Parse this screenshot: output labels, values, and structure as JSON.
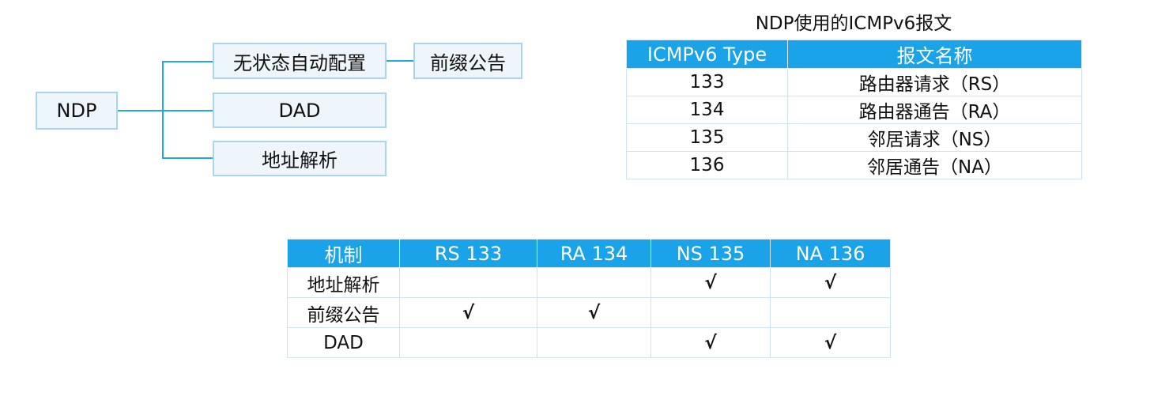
{
  "tree": {
    "root": "NDP",
    "branches": [
      "无状态自动配置",
      "DAD",
      "地址解析"
    ],
    "sub": "前缀公告"
  },
  "type_table": {
    "title": "NDP使用的ICMPv6报文",
    "headers": [
      "ICMPv6 Type",
      "报文名称"
    ],
    "rows": [
      [
        "133",
        "路由器请求（RS）"
      ],
      [
        "134",
        "路由器通告（RA）"
      ],
      [
        "135",
        "邻居请求（NS）"
      ],
      [
        "136",
        "邻居通告（NA）"
      ]
    ]
  },
  "mech_table": {
    "headers": [
      "机制",
      "RS 133",
      "RA 134",
      "NS 135",
      "NA 136"
    ],
    "rows": [
      [
        "地址解析",
        "",
        "",
        "√",
        "√"
      ],
      [
        "前缀公告",
        "√",
        "√",
        "",
        ""
      ],
      [
        "DAD",
        "",
        "",
        "√",
        "√"
      ]
    ]
  },
  "colors": {
    "header_bg": "#1aa3e8",
    "connector": "#22aadf",
    "box_border": "#a9d6ef",
    "box_bg": "#eef6fb"
  }
}
